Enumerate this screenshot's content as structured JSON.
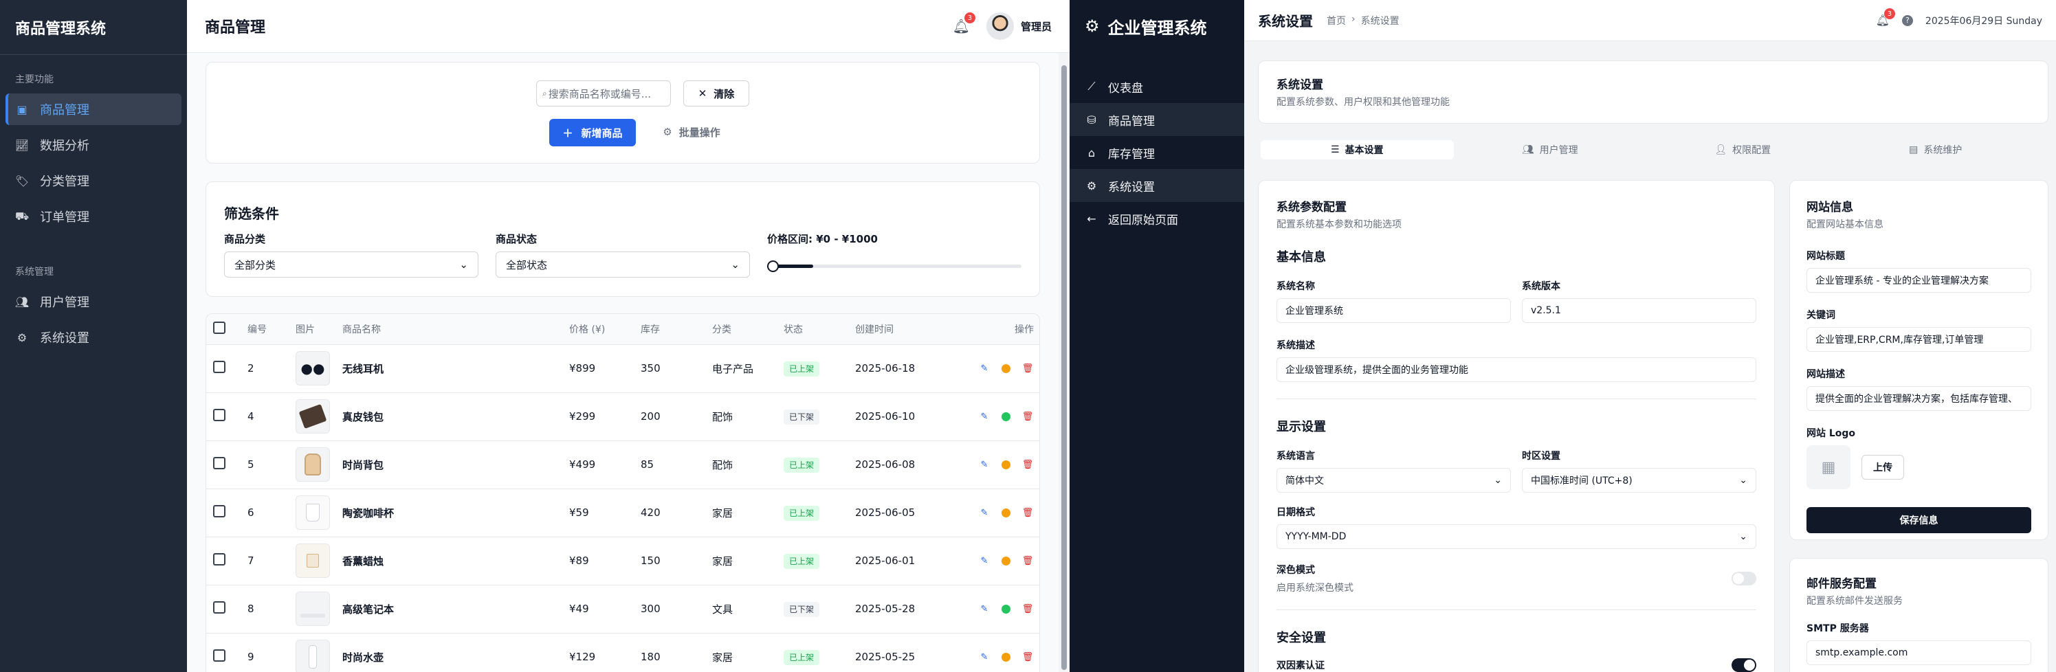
{
  "app_a": {
    "brand": "商品管理系统",
    "sections": [
      {
        "title": "主要功能",
        "items": [
          "商品管理",
          "数据分析",
          "分类管理",
          "订单管理"
        ]
      },
      {
        "title": "系统管理",
        "items": [
          "用户管理",
          "系统设置"
        ]
      }
    ],
    "header": {
      "title": "商品管理",
      "notif_count": "3",
      "user": "管理员"
    },
    "toolbar": {
      "search_placeholder": "搜索商品名称或编号...",
      "clear": "清除",
      "add": "新增商品",
      "batch": "批量操作"
    },
    "filters": {
      "title": "筛选条件",
      "category_label": "商品分类",
      "category_value": "全部分类",
      "status_label": "商品状态",
      "status_value": "全部状态",
      "price_label": "价格区间: ¥0 - ¥1000",
      "price_range_fill": 0.18
    },
    "table": {
      "headers": [
        "编号",
        "图片",
        "商品名称",
        "价格 (¥)",
        "库存",
        "分类",
        "状态",
        "创建时间",
        "操作"
      ],
      "rows": [
        {
          "id": "2",
          "name": "无线耳机",
          "price": "¥899",
          "stock": "350",
          "category": "电子产品",
          "status": "已上架",
          "date": "2025-06-18"
        },
        {
          "id": "4",
          "name": "真皮钱包",
          "price": "¥299",
          "stock": "200",
          "category": "配饰",
          "status": "已下架",
          "date": "2025-06-10"
        },
        {
          "id": "5",
          "name": "时尚背包",
          "price": "¥499",
          "stock": "85",
          "category": "配饰",
          "status": "已上架",
          "date": "2025-06-08"
        },
        {
          "id": "6",
          "name": "陶瓷咖啡杯",
          "price": "¥59",
          "stock": "420",
          "category": "家居",
          "status": "已上架",
          "date": "2025-06-05"
        },
        {
          "id": "7",
          "name": "香薰蜡烛",
          "price": "¥89",
          "stock": "150",
          "category": "家居",
          "status": "已上架",
          "date": "2025-06-01"
        },
        {
          "id": "8",
          "name": "高级笔记本",
          "price": "¥49",
          "stock": "300",
          "category": "文具",
          "status": "已下架",
          "date": "2025-05-28"
        },
        {
          "id": "9",
          "name": "时尚水壶",
          "price": "¥129",
          "stock": "180",
          "category": "家居",
          "status": "已上架",
          "date": "2025-05-25"
        }
      ]
    },
    "colors": {
      "accent": "#2563eb",
      "sidebar": "#1f2937",
      "on": "#16a34a",
      "off_dot": "#22c55e",
      "pause_dot": "#f59e0b",
      "delete": "#dc2626"
    }
  },
  "app_b": {
    "brand": "企业管理系统",
    "nav": [
      "仪表盘",
      "商品管理",
      "库存管理",
      "系统设置",
      "返回原始页面"
    ],
    "header": {
      "title": "系统设置",
      "crumb_home": "首页",
      "crumb_current": "系统设置",
      "notif_count": "3",
      "datetime": "2025年06月29日 Sunday"
    },
    "intro": {
      "title": "系统设置",
      "desc": "配置系统参数、用户权限和其他管理功能"
    },
    "tabs": [
      "基本设置",
      "用户管理",
      "权限配置",
      "系统维护"
    ],
    "params": {
      "title": "系统参数配置",
      "desc": "配置系统基本参数和功能选项",
      "basic_title": "基本信息",
      "name_label": "系统名称",
      "name_value": "企业管理系统",
      "version_label": "系统版本",
      "version_value": "v2.5.1",
      "desc_label": "系统描述",
      "desc_value": "企业级管理系统，提供全面的业务管理功能",
      "display_title": "显示设置",
      "lang_label": "系统语言",
      "lang_value": "简体中文",
      "tz_label": "时区设置",
      "tz_value": "中国标准时间 (UTC+8)",
      "date_label": "日期格式",
      "date_value": "YYYY-MM-DD",
      "dark_label": "深色模式",
      "dark_desc": "启用系统深色模式",
      "dark_on": false,
      "security_title": "安全设置",
      "twofa_label": "双因素认证",
      "twofa_on": true
    },
    "site": {
      "title": "网站信息",
      "desc": "配置网站基本信息",
      "site_title_label": "网站标题",
      "site_title_value": "企业管理系统 - 专业的企业管理解决方案",
      "kw_label": "关键词",
      "kw_value": "企业管理,ERP,CRM,库存管理,订单管理",
      "sdesc_label": "网站描述",
      "sdesc_value": "提供全面的企业管理解决方案，包括库存管理、",
      "logo_label": "网站 Logo",
      "upload": "上传",
      "save": "保存信息"
    },
    "mail": {
      "title": "邮件服务配置",
      "desc": "配置系统邮件发送服务",
      "smtp_label": "SMTP 服务器",
      "smtp_value": "smtp.example.com"
    }
  }
}
